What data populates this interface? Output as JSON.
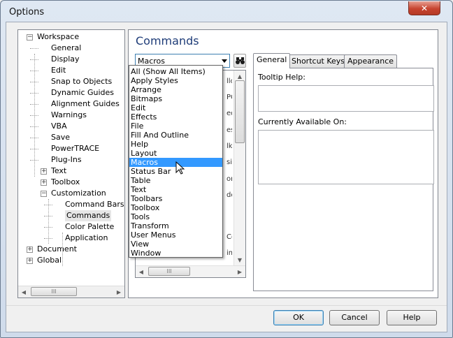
{
  "window": {
    "title": "Options",
    "close_label": "✕"
  },
  "tree": {
    "items": [
      {
        "label": "Workspace",
        "level": 0,
        "expander": "−"
      },
      {
        "label": "General",
        "level": 1
      },
      {
        "label": "Display",
        "level": 1
      },
      {
        "label": "Edit",
        "level": 1
      },
      {
        "label": "Snap to Objects",
        "level": 1
      },
      {
        "label": "Dynamic Guides",
        "level": 1
      },
      {
        "label": "Alignment Guides",
        "level": 1
      },
      {
        "label": "Warnings",
        "level": 1
      },
      {
        "label": "VBA",
        "level": 1
      },
      {
        "label": "Save",
        "level": 1
      },
      {
        "label": "PowerTRACE",
        "level": 1
      },
      {
        "label": "Plug-Ins",
        "level": 1
      },
      {
        "label": "Text",
        "level": 1,
        "expander": "+"
      },
      {
        "label": "Toolbox",
        "level": 1,
        "expander": "+"
      },
      {
        "label": "Customization",
        "level": 1,
        "expander": "−"
      },
      {
        "label": "Command Bars",
        "level": 2
      },
      {
        "label": "Commands",
        "level": 2,
        "selected": true
      },
      {
        "label": "Color Palette",
        "level": 2
      },
      {
        "label": "Application",
        "level": 2
      },
      {
        "label": "Document",
        "level": 0,
        "expander": "+"
      },
      {
        "label": "Global",
        "level": 0,
        "expander": "+"
      }
    ]
  },
  "panel": {
    "title": "Commands",
    "combo_value": "Macros",
    "list_edge_glyphs": [
      "llc",
      "PC",
      "ed",
      "es",
      "lk",
      "sis",
      "or",
      "do",
      "Co",
      "im"
    ]
  },
  "tabs": [
    {
      "label": "General",
      "active": true
    },
    {
      "label": "Shortcut Keys",
      "active": false
    },
    {
      "label": "Appearance",
      "active": false
    }
  ],
  "general_tab": {
    "tooltip_label": "Tooltip Help:",
    "available_label": "Currently Available On:"
  },
  "dropdown": {
    "selected": "Macros",
    "options": [
      "All (Show All Items)",
      "Apply Styles",
      "Arrange",
      "Bitmaps",
      "Edit",
      "Effects",
      "File",
      "Fill And Outline",
      "Help",
      "Layout",
      "Macros",
      "Status Bar",
      "Table",
      "Text",
      "Toolbars",
      "Toolbox",
      "Tools",
      "Transform",
      "User Menus",
      "View",
      "Window"
    ]
  },
  "buttons": {
    "ok": "OK",
    "cancel": "Cancel",
    "help": "Help"
  },
  "scroll_grip": "III"
}
